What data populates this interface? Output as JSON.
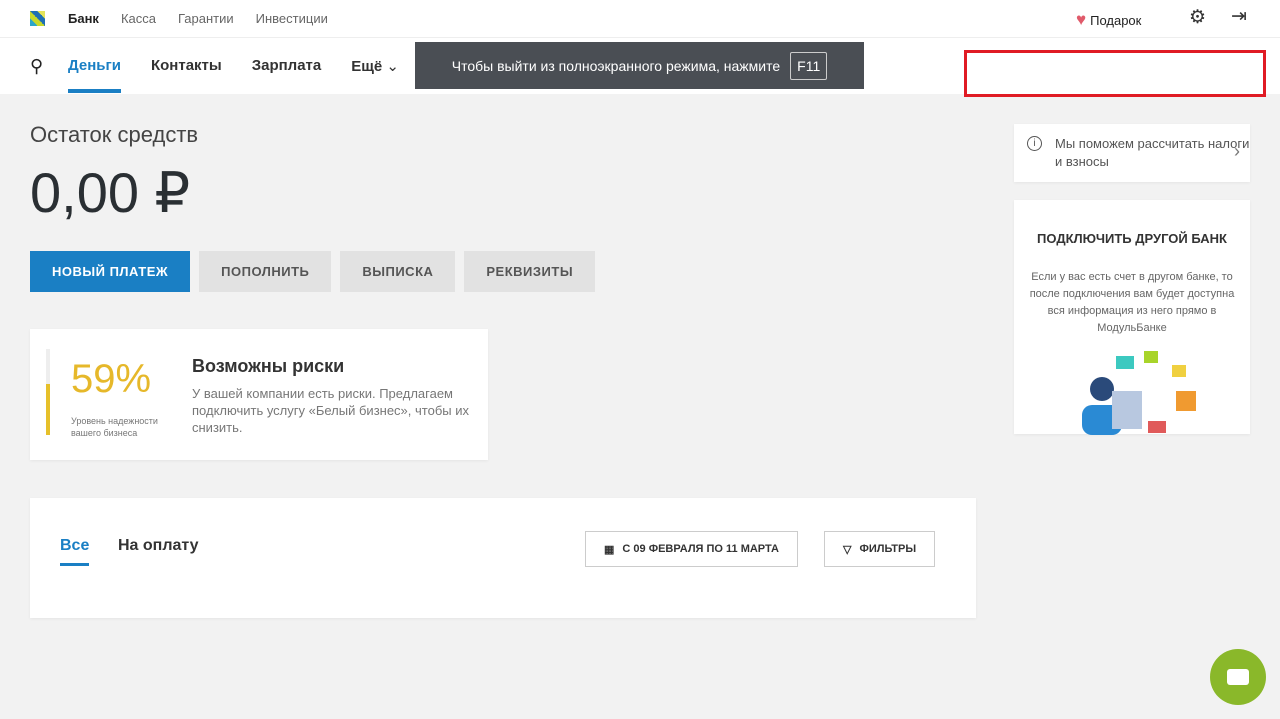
{
  "top": {
    "links": [
      "Банк",
      "Касса",
      "Гарантии",
      "Инвестиции"
    ],
    "gift": "Подарок"
  },
  "nav": {
    "items": [
      "Деньги",
      "Контакты",
      "Зарплата",
      "Ещё"
    ]
  },
  "toast": {
    "text": "Чтобы выйти из полноэкранного режима, нажмите",
    "key": "F11"
  },
  "balance": {
    "title": "Остаток средств",
    "amount": "0,00 ₽"
  },
  "actions": [
    "НОВЫЙ ПЛАТЕЖ",
    "ПОПОЛНИТЬ",
    "ВЫПИСКА",
    "РЕКВИЗИТЫ"
  ],
  "risk": {
    "percent": "59%",
    "value": 59,
    "label": "Уровень надежности вашего бизнеса",
    "title": "Возможны риски",
    "text": "У вашей компании есть риски. Предлагаем подключить услугу «Белый бизнес», чтобы их снизить."
  },
  "ops": {
    "tabs": [
      "Все",
      "На оплату"
    ],
    "date": "С 09 ФЕВРАЛЯ ПО 11 МАРТА",
    "filters": "ФИЛЬТРЫ"
  },
  "tax": {
    "text": "Мы поможем рассчитать налоги и взносы"
  },
  "bank": {
    "title": "ПОДКЛЮЧИТЬ ДРУГОЙ БАНК",
    "text": "Если у вас есть счет в другом банке, то после подключения вам будет доступна вся информация из него прямо в МодульБанке"
  }
}
